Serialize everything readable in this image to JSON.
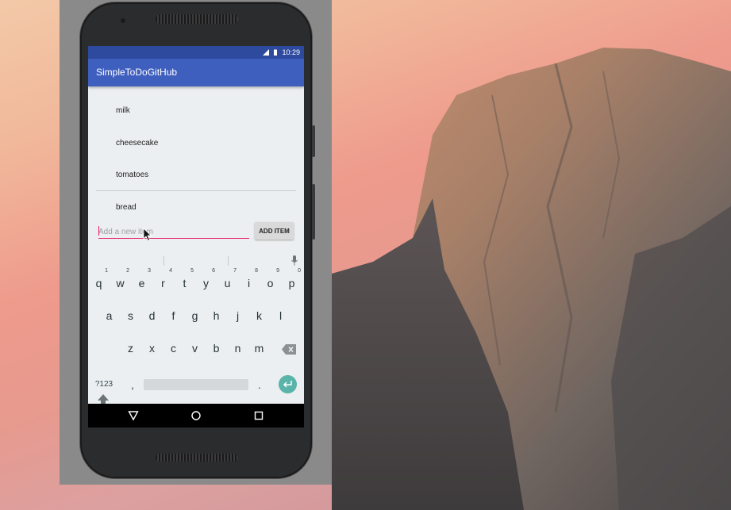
{
  "status_bar": {
    "time": "10:29",
    "icons": [
      "signal-icon",
      "battery-icon"
    ]
  },
  "app_bar": {
    "title": "SimpleToDoGitHub"
  },
  "todo_items": [
    "milk",
    "cheesecake",
    "tomatoes",
    "bread"
  ],
  "add_row": {
    "placeholder": "Add a new item",
    "button_label": "ADD ITEM"
  },
  "keyboard": {
    "row1": [
      {
        "key": "q",
        "hint": "1"
      },
      {
        "key": "w",
        "hint": "2"
      },
      {
        "key": "e",
        "hint": "3"
      },
      {
        "key": "r",
        "hint": "4"
      },
      {
        "key": "t",
        "hint": "5"
      },
      {
        "key": "y",
        "hint": "6"
      },
      {
        "key": "u",
        "hint": "7"
      },
      {
        "key": "i",
        "hint": "8"
      },
      {
        "key": "o",
        "hint": "9"
      },
      {
        "key": "p",
        "hint": "0"
      }
    ],
    "row2": [
      "a",
      "s",
      "d",
      "f",
      "g",
      "h",
      "j",
      "k",
      "l"
    ],
    "row3": [
      "z",
      "x",
      "c",
      "v",
      "b",
      "n",
      "m"
    ],
    "num_label": "?123",
    "comma": ",",
    "period": "."
  },
  "colors": {
    "status_bar": "#2e4a9e",
    "app_bar": "#3f5fbf",
    "input_underline": "#e91e63",
    "enter_key": "#5bb4a9"
  }
}
